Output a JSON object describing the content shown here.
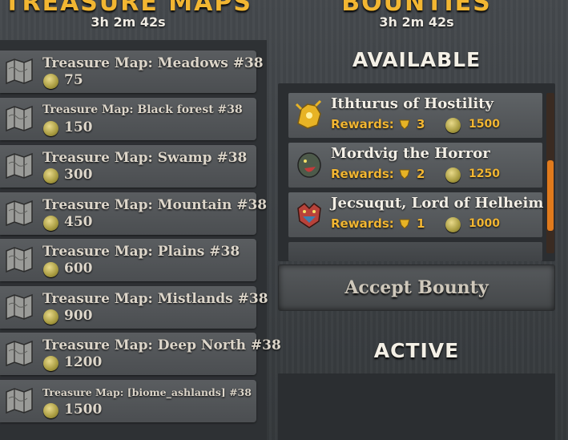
{
  "treasure_maps": {
    "title": "TREASURE MAPS",
    "timer": "3h 2m 42s",
    "items": [
      {
        "name": "Treasure Map: Meadows #38",
        "price": "75"
      },
      {
        "name": "Treasure Map: Black forest #38",
        "price": "150"
      },
      {
        "name": "Treasure Map: Swamp #38",
        "price": "300"
      },
      {
        "name": "Treasure Map: Mountain #38",
        "price": "450"
      },
      {
        "name": "Treasure Map: Plains #38",
        "price": "600"
      },
      {
        "name": "Treasure Map: Mistlands #38",
        "price": "900"
      },
      {
        "name": "Treasure Map: Deep North #38",
        "price": "1200"
      },
      {
        "name": "Treasure Map: [biome_ashlands] #38",
        "price": "1500"
      }
    ]
  },
  "bounties": {
    "title": "BOUNTIES",
    "timer": "3h 2m 42s",
    "available_label": "AVAILABLE",
    "rewards_label": "Rewards:",
    "items": [
      {
        "name": "Ithturus of Hostility",
        "trophies": "3",
        "coins": "1500",
        "icon": "golden-beast-icon"
      },
      {
        "name": "Mordvig the Horror",
        "trophies": "2",
        "coins": "1250",
        "icon": "serpent-head-icon"
      },
      {
        "name": "Jecsuqut, Lord of Helheim",
        "trophies": "1",
        "coins": "1000",
        "icon": "dragon-head-icon"
      }
    ],
    "accept_label": "Accept Bounty",
    "active_label": "ACTIVE"
  },
  "colors": {
    "accent_gold": "#f2b632",
    "scroll_thumb": "#e07a1c"
  }
}
